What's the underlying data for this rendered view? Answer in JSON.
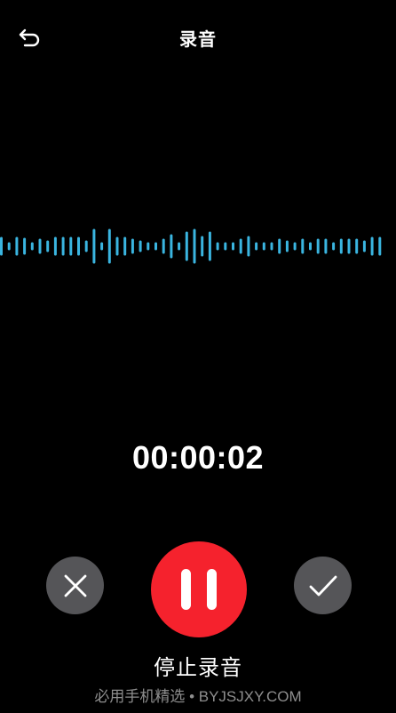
{
  "header": {
    "back_icon": "undo-arrow-icon",
    "title": "录音"
  },
  "recording": {
    "elapsed": "00:00:02",
    "waveform_color": "#3ab5e0"
  },
  "controls": {
    "cancel_icon": "close-icon",
    "pause_icon": "pause-icon",
    "confirm_icon": "checkmark-icon",
    "pause_color": "#f5222d",
    "secondary_color": "#555558",
    "action_label": "停止录音"
  },
  "watermark": {
    "text": "必用手机精选 • BYJSJXY.COM"
  }
}
